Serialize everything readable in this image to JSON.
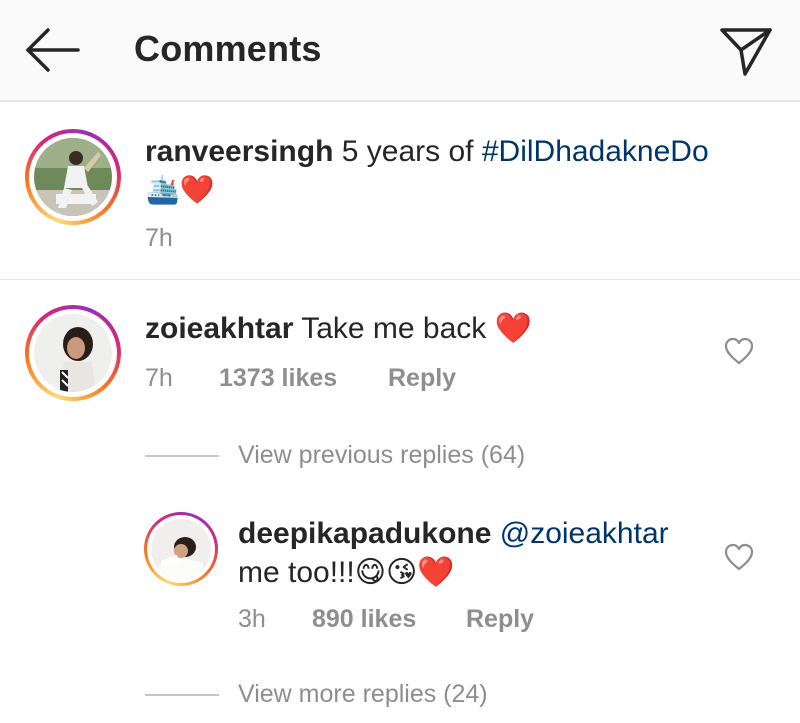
{
  "header": {
    "title": "Comments",
    "back_icon": "arrow-left-icon",
    "send_icon": "paper-plane-icon"
  },
  "caption": {
    "username": "ranveersingh",
    "text": "5 years of",
    "hashtag": "#DilDhadakneDo",
    "emoji": "🛳️❤️",
    "time": "7h"
  },
  "comment": {
    "username": "zoieakhtar",
    "text": "Take me back",
    "emoji": "❤️",
    "time": "7h",
    "likes": "1373 likes",
    "reply_label": "Reply",
    "view_previous": "View previous replies (64)"
  },
  "reply": {
    "username": "deepikapadukone",
    "mention": "@zoieakhtar",
    "text": "me too!!!",
    "emoji": "😋😘❤️",
    "time": "3h",
    "likes": "890 likes",
    "reply_label": "Reply",
    "view_more": "View more replies (24)"
  },
  "colors": {
    "link": "#003569",
    "muted": "#8e8e8e",
    "heart": "#ed1c24"
  }
}
